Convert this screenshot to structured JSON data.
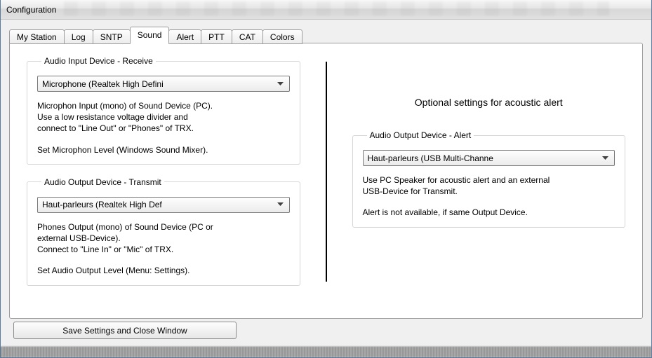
{
  "window": {
    "title": "Configuration"
  },
  "tabs": [
    {
      "label": "My Station",
      "active": false
    },
    {
      "label": "Log",
      "active": false
    },
    {
      "label": "SNTP",
      "active": false
    },
    {
      "label": "Sound",
      "active": true
    },
    {
      "label": "Alert",
      "active": false
    },
    {
      "label": "PTT",
      "active": false
    },
    {
      "label": "CAT",
      "active": false
    },
    {
      "label": "Colors",
      "active": false
    }
  ],
  "left": {
    "input_group": {
      "legend": "Audio Input Device - Receive",
      "combo_value": "Microphone (Realtek High Defini",
      "help1": "Microphon Input (mono) of Sound Device (PC).",
      "help2": "Use a low resistance voltage divider and",
      "help3": "connect to \"Line Out\" or \"Phones\" of TRX.",
      "help4": "Set Microphon Level (Windows Sound Mixer)."
    },
    "output_group": {
      "legend": "Audio Output Device - Transmit",
      "combo_value": "Haut-parleurs (Realtek High Def",
      "help1": "Phones Output (mono) of Sound Device (PC or",
      "help2": "external USB-Device).",
      "help3": "Connect to \"Line In\" or \"Mic\" of TRX.",
      "help4": "Set Audio Output Level (Menu: Settings)."
    }
  },
  "right": {
    "heading": "Optional settings for acoustic alert",
    "alert_group": {
      "legend": "Audio Output Device - Alert",
      "combo_value": "Haut-parleurs (USB Multi-Channe",
      "help1": "Use PC Speaker for acoustic alert and an external",
      "help2": "USB-Device for Transmit.",
      "help3": "Alert is not available, if same Output Device."
    }
  },
  "save_button": "Save Settings and Close Window"
}
